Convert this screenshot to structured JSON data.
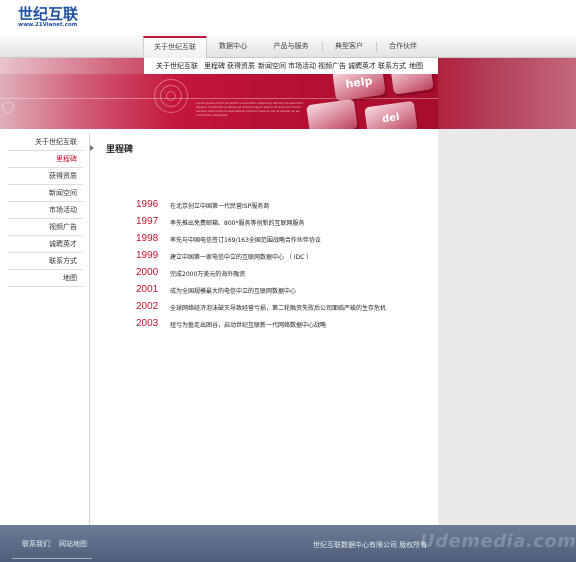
{
  "logo": {
    "name": "世纪互联",
    "url": "www.21Vianet.com"
  },
  "nav": {
    "tabs": [
      {
        "label": "关于世纪互联",
        "active": true
      },
      {
        "label": "数据中心",
        "active": false
      },
      {
        "label": "产品与服务",
        "active": false
      },
      {
        "label": "典型客户",
        "active": false
      },
      {
        "label": "合作伙伴",
        "active": false
      }
    ]
  },
  "subnav": {
    "items": [
      "关于世纪互联",
      "里程碑",
      "获得资质",
      "新闻空间",
      "市场活动",
      "视频广告",
      "诚聘英才",
      "联系方式",
      "地图"
    ]
  },
  "banner": {
    "key_help": "help",
    "key_del": "del",
    "caption": "Lorem ipsum dolor sit amet consectetur adipiscing elit sed do eiusmod tempor incididunt ut labore et dolore magna aliqua Ut enim ad minim veniam quis nostrud exercitation ullamco laboris nisi ut aliquip ex ea commodo consequat"
  },
  "sidebar": {
    "items": [
      {
        "label": "关于世纪互联",
        "current": false
      },
      {
        "label": "里程碑",
        "current": true
      },
      {
        "label": "获得资质",
        "current": false
      },
      {
        "label": "新闻空间",
        "current": false
      },
      {
        "label": "市场活动",
        "current": false
      },
      {
        "label": "视频广告",
        "current": false
      },
      {
        "label": "诚聘英才",
        "current": false
      },
      {
        "label": "联系方式",
        "current": false
      },
      {
        "label": "地图",
        "current": false
      }
    ]
  },
  "main": {
    "title": "里程碑",
    "milestones": [
      {
        "year": "1996",
        "event": "在北京创立中国第一代民营ISP服务商"
      },
      {
        "year": "1997",
        "event": "率先推出免费邮箱、800*服务等创新的互联网服务"
      },
      {
        "year": "1998",
        "event": "率先与中国电信签订169/163全国范围战略合作伙伴协议"
      },
      {
        "year": "1999",
        "event": "建立中国第一家电信中立的互联网数据中心 （ IDC ）"
      },
      {
        "year": "2000",
        "event": "完成2000万美元的海外融资"
      },
      {
        "year": "2001",
        "event": "成为全国规模最大的电信中立的互联网数据中心"
      },
      {
        "year": "2002",
        "event": "全球网络经济泡沫破灭导致经营亏损，第二轮融资失败后公司面临严峻的生存危机"
      },
      {
        "year": "2003",
        "event": "扭亏为盈走出困谷，启动世纪互联新一代网络数据中心战略"
      }
    ]
  },
  "footer": {
    "links": [
      "联系我们",
      "网站地图"
    ],
    "copyright": "世纪互联数据中心有限公司  版权所有",
    "watermark": "Udemedia.com"
  },
  "colors": {
    "accent": "#c8102e",
    "brand": "#1e4fa0",
    "footer": "#5b6a86"
  }
}
